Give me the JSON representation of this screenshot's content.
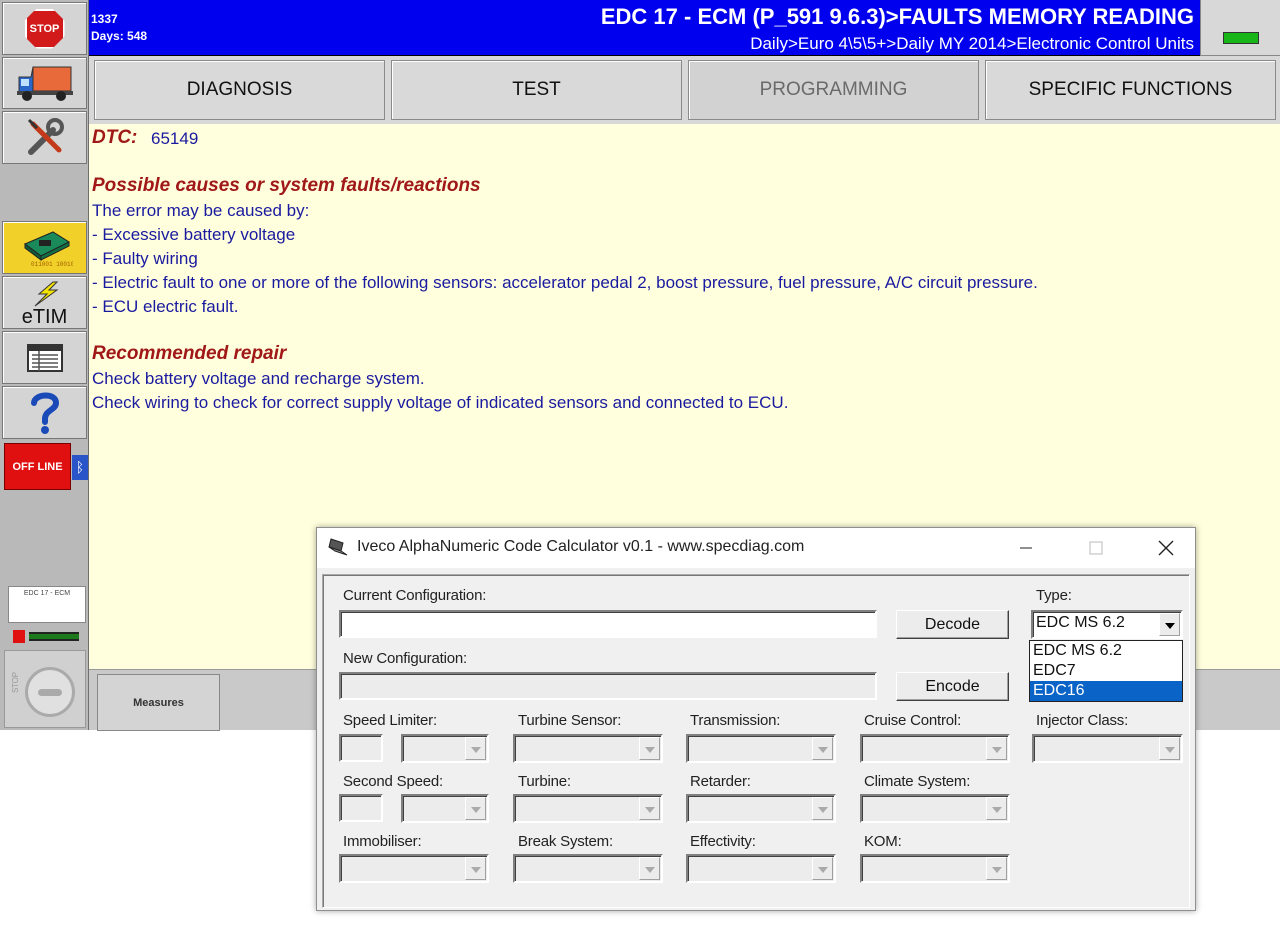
{
  "header": {
    "code": "1337",
    "days": "Days: 548",
    "title": "EDC 17 - ECM (P_591 9.6.3)>FAULTS MEMORY READING",
    "path": "Daily>Euro 4\\5\\5+>Daily MY 2014>Electronic Control Units"
  },
  "sidebar": {
    "stop_label": "STOP",
    "etim_label": "eTIM",
    "offline_label": "OFF LINE",
    "ecu_mini_label": "EDC 17 - ECM",
    "stop_round_label": "STOP"
  },
  "tabs": [
    {
      "label": "DIAGNOSIS"
    },
    {
      "label": "TEST"
    },
    {
      "label": "PROGRAMMING"
    },
    {
      "label": "SPECIFIC FUNCTIONS"
    }
  ],
  "content": {
    "dtc_label": "DTC:",
    "dtc_value": "65149",
    "causes_heading": "Possible causes or system faults/reactions",
    "causes_intro": "The error may be caused by:",
    "causes": [
      "- Excessive battery voltage",
      "- Faulty wiring",
      "- Electric fault to one or more of the following sensors: accelerator pedal 2, boost pressure, fuel pressure, A/C circuit pressure.",
      "- ECU electric fault."
    ],
    "repair_heading": "Recommended repair",
    "repair": [
      "Check battery voltage and recharge system.",
      "Check wiring to check for correct supply voltage of indicated sensors and connected to ECU."
    ]
  },
  "bottom": {
    "measures_label": "Measures"
  },
  "dialog": {
    "title": "Iveco AlphaNumeric Code Calculator v0.1 - www.specdiag.com",
    "current_config_label": "Current Configuration:",
    "current_config_value": "",
    "new_config_label": "New Configuration:",
    "new_config_value": "",
    "decode_label": "Decode",
    "encode_label": "Encode",
    "type_label": "Type:",
    "type_value": "EDC MS 6.2",
    "type_options": [
      "EDC MS 6.2",
      "EDC7",
      "EDC16"
    ],
    "type_highlighted": "EDC16",
    "fields": {
      "speed_limiter": "Speed Limiter:",
      "turbine_sensor": "Turbine Sensor:",
      "transmission": "Transmission:",
      "cruise_control": "Cruise Control:",
      "injector_class": "Injector Class:",
      "second_speed": "Second Speed:",
      "turbine": "Turbine:",
      "retarder": "Retarder:",
      "climate_system": "Climate System:",
      "immobiliser": "Immobiliser:",
      "break_system": "Break System:",
      "effectivity": "Effectivity:",
      "kom": "KOM:"
    }
  },
  "colors": {
    "header_blue": "#0000ee",
    "content_bg": "#ffffdd",
    "content_text": "#1a1aa0",
    "heading_red": "#a01818",
    "offline_red": "#e01010",
    "selection_blue": "#0a64c8"
  }
}
